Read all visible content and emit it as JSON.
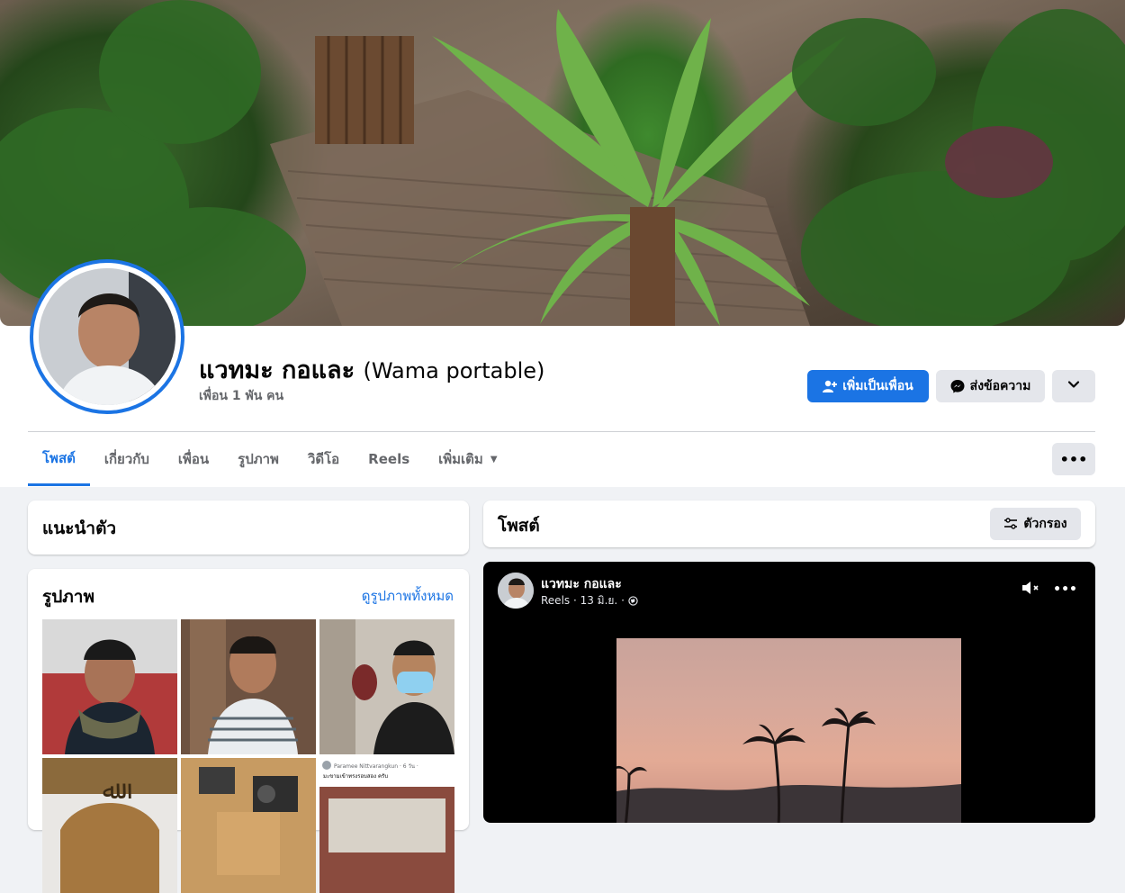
{
  "profile": {
    "name": "แวทมะ กอและ",
    "alt_name": "(Wama portable)",
    "friends_count": "เพื่อน 1 พัน คน"
  },
  "actions": {
    "add_friend": "เพิ่มเป็นเพื่อน",
    "message": "ส่งข้อความ"
  },
  "tabs": [
    {
      "label": "โพสต์",
      "active": true
    },
    {
      "label": "เกี่ยวกับ"
    },
    {
      "label": "เพื่อน"
    },
    {
      "label": "รูปภาพ"
    },
    {
      "label": "วิดีโอ"
    },
    {
      "label": "Reels"
    },
    {
      "label": "เพิ่มเติม"
    }
  ],
  "intro": {
    "title": "แนะนำตัว"
  },
  "photos": {
    "title": "รูปภาพ",
    "see_all": "ดูรูปภาพทั้งหมด",
    "thumb6_header": "Paramee Nittvarangkun · 6 วัน ·",
    "thumb6_caption": "มะขามเข้าทรงรอบสอง ครับ"
  },
  "posts": {
    "title": "โพสต์",
    "filter_label": "ตัวกรอง",
    "items": [
      {
        "author": "แวทมะ กอและ",
        "meta": "Reels · 13 มิ.ย. ·"
      }
    ]
  },
  "colors": {
    "accent": "#1b74e4",
    "background": "#f0f2f5"
  },
  "icons": [
    "add-friend-icon",
    "messenger-icon",
    "chevron-down-icon",
    "more-icon",
    "filter-icon",
    "mute-icon",
    "globe-icon"
  ]
}
